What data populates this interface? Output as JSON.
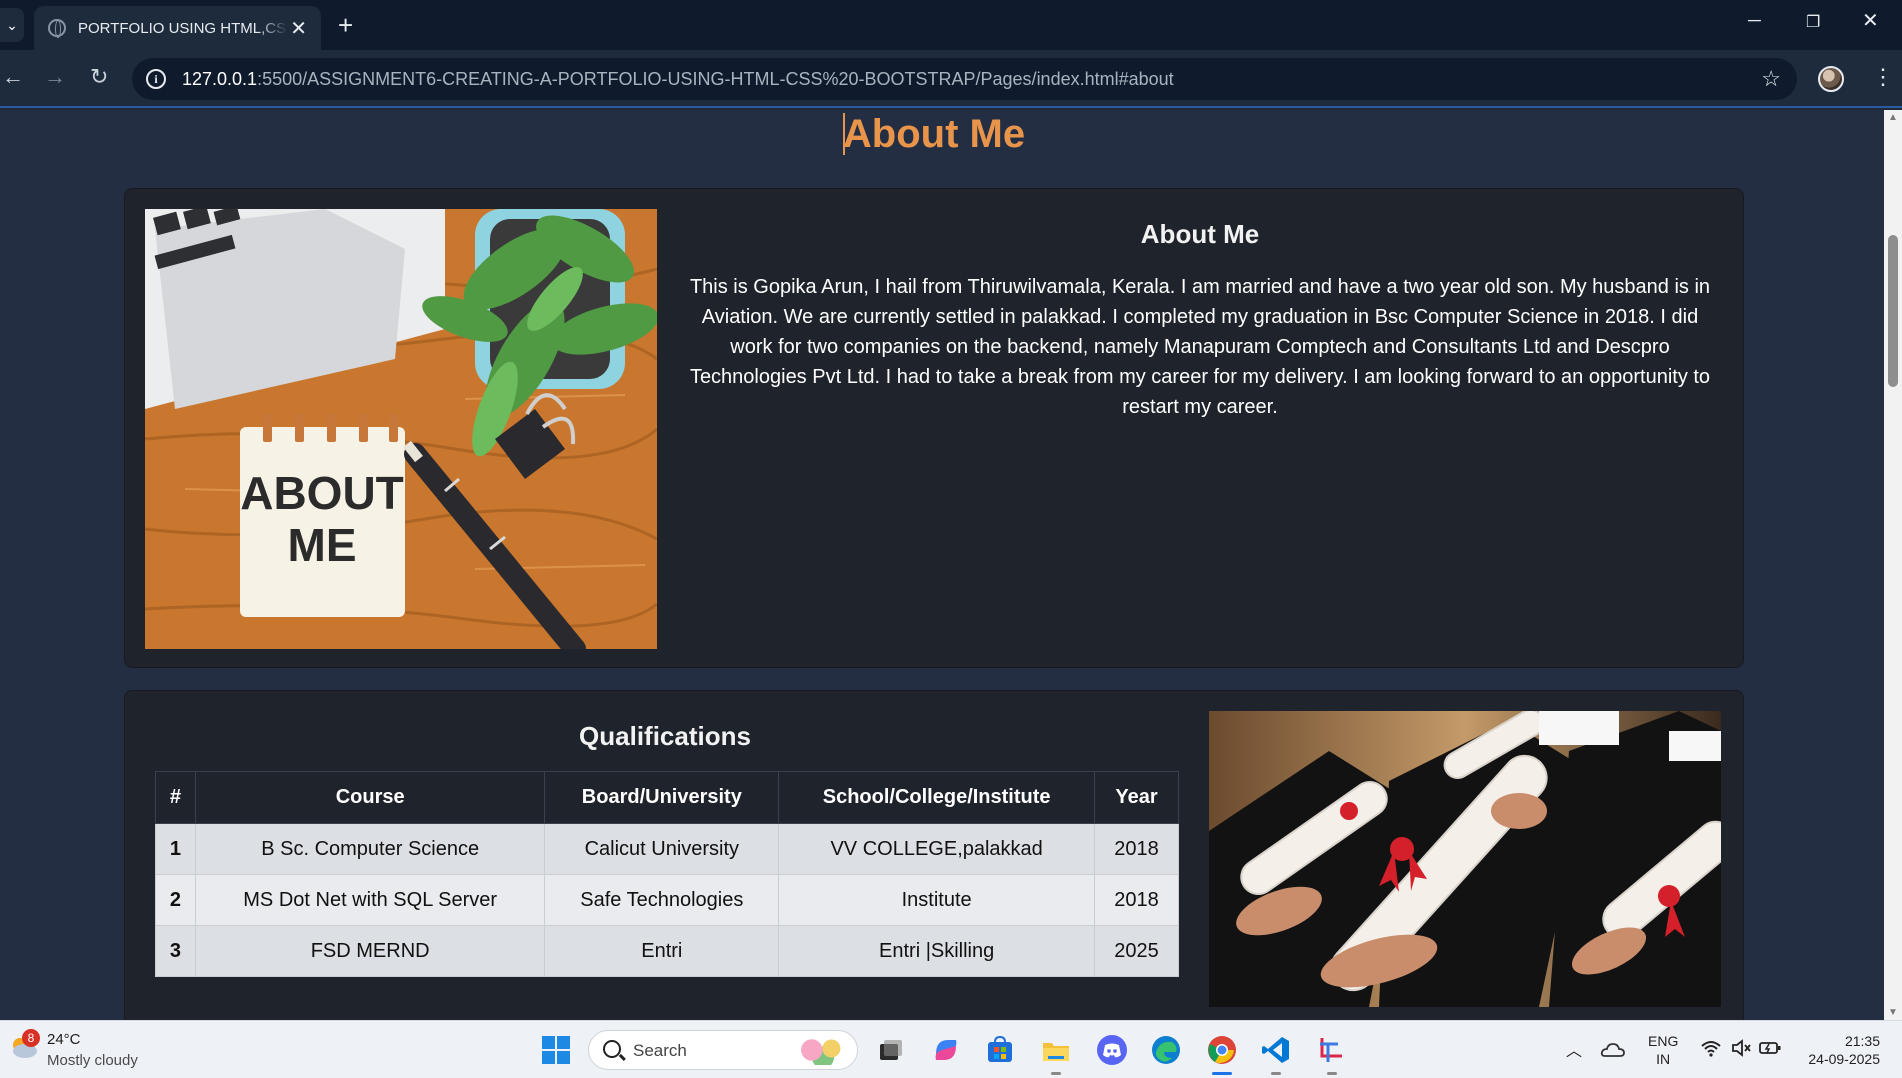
{
  "browser": {
    "tab_title": "PORTFOLIO USING HTML,CSS & BOOTSTRAP",
    "tab_close": "✕",
    "new_tab": "+",
    "url_host": "127.0.0.1",
    "url_rest": ":5500/ASSIGNMENT6-CREATING-A-PORTFOLIO-USING-HTML-CSS%20-BOOTSTRAP/Pages/index.html#about"
  },
  "page": {
    "heading": "About Me",
    "about": {
      "subtitle": "About Me",
      "image_text_line1": "ABOUT",
      "image_text_line2": "ME",
      "paragraph": "This is Gopika Arun, I hail from Thiruwilvamala, Kerala. I am married and have a two year old son. My husband is in Aviation. We are currently settled in palakkad. I completed my graduation in Bsc Computer Science in 2018. I did work for two companies on the backend, namely Manapuram Comptech and Consultants Ltd and Descpro Technologies Pvt Ltd. I had to take a break from my career for my delivery. I am looking forward to an opportunity to restart my career."
    },
    "qualifications": {
      "title": "Qualifications",
      "headers": [
        "#",
        "Course",
        "Board/University",
        "School/College/Institute",
        "Year"
      ],
      "rows": [
        [
          "1",
          "B Sc. Computer Science",
          "Calicut University",
          "VV COLLEGE,palakkad",
          "2018"
        ],
        [
          "2",
          "MS Dot Net with SQL Server",
          "Safe Technologies",
          "Institute",
          "2018"
        ],
        [
          "3",
          "FSD MERND",
          "Entri",
          "Entri |Skilling",
          "2025"
        ]
      ]
    }
  },
  "taskbar": {
    "weather_badge": "8",
    "weather_temp": "24°C",
    "weather_desc": "Mostly cloudy",
    "search_label": "Search",
    "lang_line1": "ENG",
    "lang_line2": "IN",
    "time": "21:35",
    "date": "24-09-2025"
  },
  "colors": {
    "heading_accent": "#e8954b",
    "page_bg": "#242e42",
    "card_bg": "#1f242c"
  }
}
